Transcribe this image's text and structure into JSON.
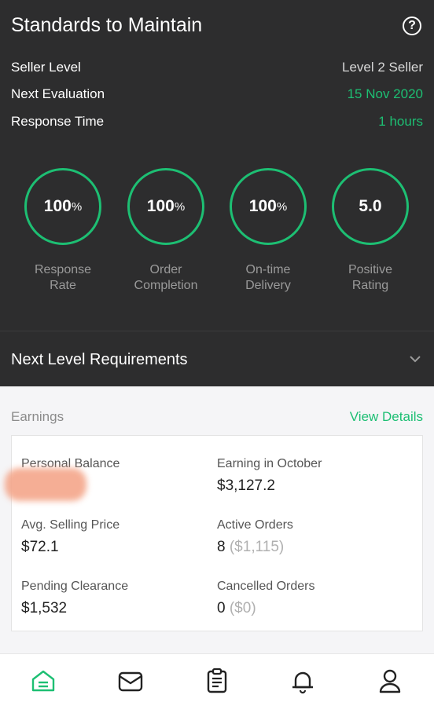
{
  "header": {
    "title": "Standards to Maintain",
    "help_icon": "question-circle-icon"
  },
  "info": [
    {
      "label": "Seller Level",
      "value": "Level 2 Seller"
    },
    {
      "label": "Next Evaluation",
      "value": "15 Nov 2020"
    },
    {
      "label": "Response Time",
      "value": "1 hours"
    }
  ],
  "stats": [
    {
      "value": "100",
      "unit": "%",
      "label_line1": "Response",
      "label_line2": "Rate"
    },
    {
      "value": "100",
      "unit": "%",
      "label_line1": "Order",
      "label_line2": "Completion"
    },
    {
      "value": "100",
      "unit": "%",
      "label_line1": "On-time",
      "label_line2": "Delivery"
    },
    {
      "value": "5.0",
      "unit": "",
      "label_line1": "Positive",
      "label_line2": "Rating"
    }
  ],
  "next_level": {
    "title": "Next Level Requirements"
  },
  "earnings": {
    "label": "Earnings",
    "view_details": "View Details",
    "personal_balance": {
      "label": "Personal Balance"
    },
    "earning_october": {
      "label": "Earning in October",
      "value": "$3,127.2"
    },
    "avg_price": {
      "label": "Avg. Selling Price",
      "value": "$72.1"
    },
    "active_orders": {
      "label": "Active Orders",
      "count": "8",
      "amount": "($1,115)"
    },
    "pending": {
      "label": "Pending Clearance",
      "value": "$1,532"
    },
    "cancelled": {
      "label": "Cancelled Orders",
      "count": "0",
      "amount": "($0)"
    }
  },
  "colors": {
    "accent": "#1dbf73",
    "dark_bg": "#2d2d2e"
  },
  "nav_icons": [
    "home-icon",
    "inbox-icon",
    "orders-icon",
    "notifications-icon",
    "profile-icon"
  ]
}
